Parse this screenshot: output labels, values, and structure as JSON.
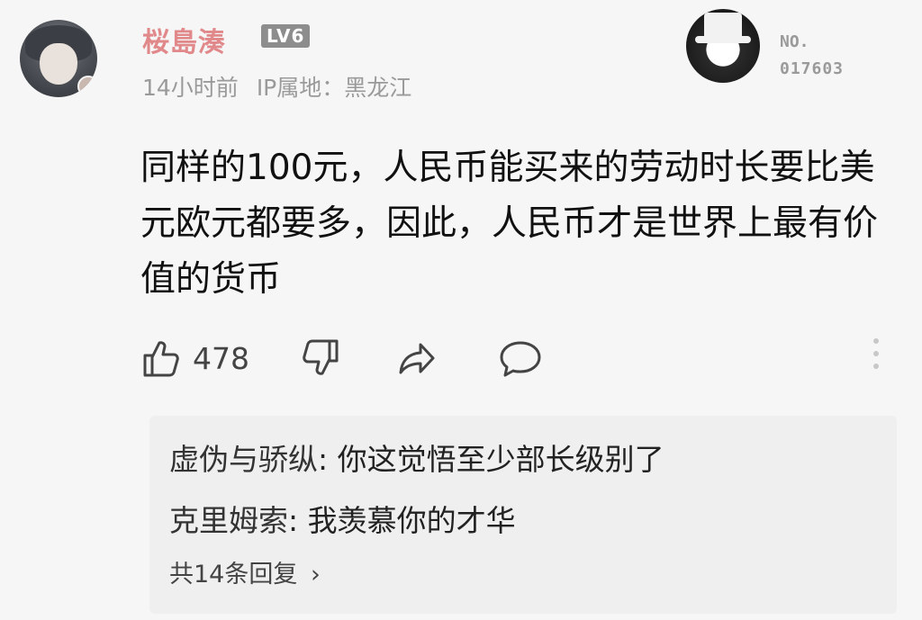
{
  "user": {
    "name": "桜島湊",
    "level": "LV6",
    "time": "14小时前",
    "ip_location": "IP属地：黑龙江"
  },
  "badge": {
    "no_label": "NO.",
    "no_number": "017603"
  },
  "comment": {
    "text": "同样的100元，人民币能买来的劳动时长要比美元欧元都要多，因此，人民币才是世界上最有价值的货币"
  },
  "actions": {
    "like_count": "478",
    "icons": [
      "thumbs-up-icon",
      "thumbs-down-icon",
      "share-icon",
      "comment-icon",
      "more-icon"
    ]
  },
  "replies": {
    "items": [
      {
        "name": "虚伪与骄纵",
        "text": "你这觉悟至少部长级别了"
      },
      {
        "name": "克里姆索",
        "text": "我羡慕你的才华"
      }
    ],
    "total_label": "共14条回复",
    "chevron": "›"
  }
}
